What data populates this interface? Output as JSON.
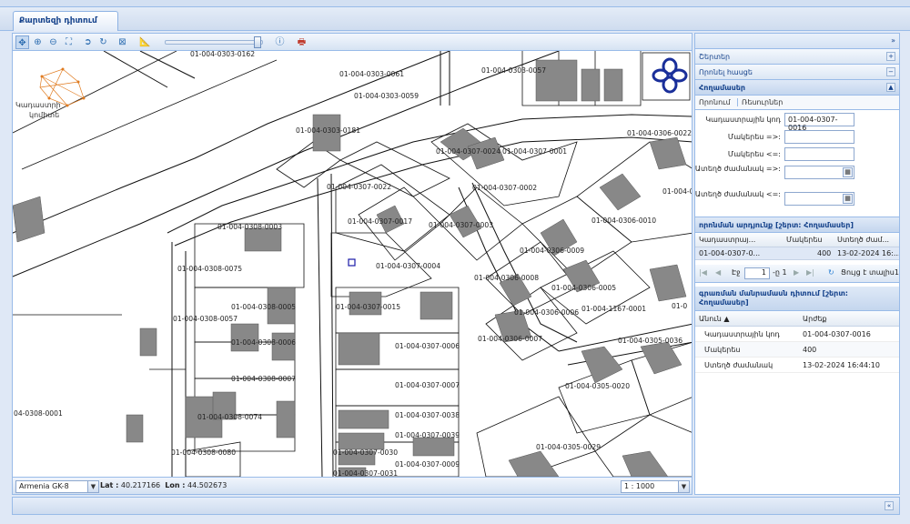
{
  "tabs": [
    {
      "label": "Քարտեզի դիտում"
    }
  ],
  "toolbar": {
    "items": [
      {
        "icon": "pan-icon",
        "active": true
      },
      {
        "icon": "zoom-in-icon"
      },
      {
        "icon": "zoom-out-icon"
      },
      {
        "icon": "full-extent-icon"
      },
      {
        "icon": "previous-extent-icon"
      },
      {
        "icon": "next-extent-icon"
      },
      {
        "icon": "zoom-box-icon"
      },
      {
        "icon": "measure-icon"
      },
      {
        "icon": "info-icon"
      },
      {
        "icon": "print-icon"
      }
    ],
    "zoom_level": 0.98
  },
  "map": {
    "logo_text": [
      "Կադաստրի",
      "կոմիտե"
    ],
    "parcel_labels": [
      "01-004-0303-0162",
      "01-004-0303-0061",
      "01-004-0303-0057",
      "01-004-0303-0059",
      "01-004-0303-0181",
      "01-004-0307-0024",
      "01-004-0307-0001",
      "01-004-0306-0022",
      "01-004-0307-0022",
      "01-004-0307-0002",
      "01-004-0307-0017",
      "01-004-0307-0003",
      "01-004-0308-0003",
      "01-004-0306-0010",
      "01-004-0306-0009",
      "01-004-0308-0075",
      "01-004-0307-0004",
      "01-004-0306-0008",
      "01-004-0306-0005",
      "01-004-0308-0005",
      "01-004-0307-0015",
      "01-004-1167-0001",
      "01-004-0308-0057",
      "01-004-0306-0006",
      "01-004-0308-0006",
      "01-004-0306-0007",
      "01-004-0307-0006",
      "01-004-0305-0036",
      "01-004-0308-0007",
      "01-004-0307-0007",
      "01-004-0305-0020",
      "04-0308-0001",
      "01-004-0308-0074",
      "01-004-0307-0038",
      "01-004-0307-0039",
      "01-004-0305-0029",
      "01-004-0308-0080",
      "01-004-0307-0030",
      "01-004-0307-0009",
      "01-004-0307-0031",
      "01-004-0",
      "01-004-0",
      "01-0"
    ]
  },
  "status": {
    "crs": "Armenia GK-8",
    "lat_label": "Lat :",
    "lat": "40.217166",
    "lon_label": "Lon :",
    "lon": "44.502673",
    "scale": "1 : 1000"
  },
  "panel": {
    "sections": [
      {
        "label": "Շերտեր",
        "tool": "+"
      },
      {
        "label": "Որոնել հասցե",
        "tool": "−"
      },
      {
        "label": "Հողամասեր",
        "tool": "▲"
      }
    ],
    "subtabs": [
      "Որոնում",
      "Ռեսուրներ"
    ],
    "form": {
      "cadastral_label": "Կադաստրային կոդ",
      "cadastral_value": "01-004-0307-0016",
      "area_gt_label": "Մակերես =>:",
      "area_lt_label": "Մակերես <=:",
      "date_gt_label": "Ատեղծ ժամանակ =>:",
      "date_lt_label": "Ատեղծ ժամանակ <=:"
    },
    "results": {
      "title": "որոնման արդյունք [շերտ: Հողամասեր]",
      "columns": [
        "Կադաստրայ...",
        "Մակերես",
        "Ստեղծ ժամ..."
      ],
      "rows": [
        [
          "01-004-0307-0...",
          "400",
          "13-02-2024 16:..."
        ]
      ]
    },
    "pager": {
      "page_label": "Էջ",
      "page": "1",
      "of_label": "-ը 1",
      "refresh_label": "Ցույց է տալիս1"
    },
    "attributes": {
      "title": "գրառման մանրամասն դիտում [շերտ: Հողամասեր]",
      "columns": [
        "Անուն ▲",
        "Արժեք"
      ],
      "rows": [
        [
          "Կադաստրային կոդ",
          "01-004-0307-0016"
        ],
        [
          "Մակերես",
          "400"
        ],
        [
          "Ստեղծ ժամանակ",
          "13-02-2024 16:44:10"
        ]
      ]
    },
    "collapse_icon": "»"
  },
  "bottom": {
    "expand_icon": "«"
  }
}
